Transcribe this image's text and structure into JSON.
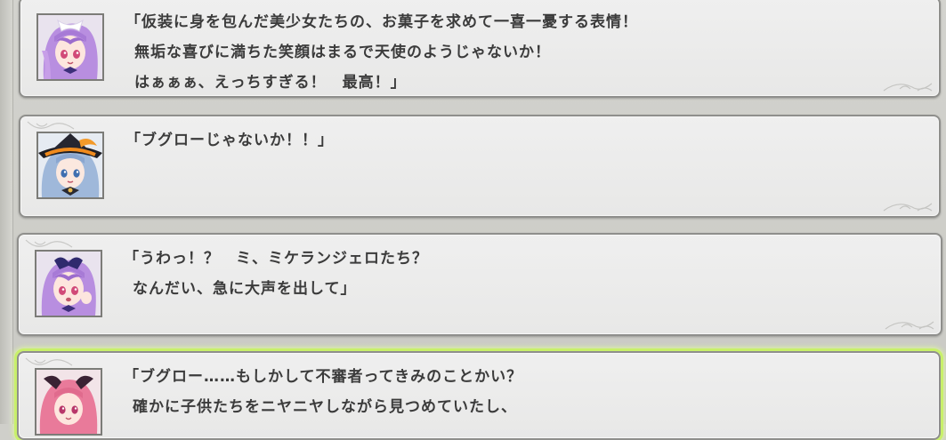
{
  "backlog": {
    "entries": [
      {
        "character": "purple-haired girl (bunny ears, ribbon)",
        "lines": [
          "「仮装に身を包んだ美少女たちの、お菓子を求めて一喜一憂する表情！",
          "無垢な喜びに満ちた笑顔はまるで天使のようじゃないか！",
          "はぁぁぁ、えっちすぎる！　最高！」"
        ]
      },
      {
        "character": "blue-haired girl (orange witch hat)",
        "lines": [
          "「ブグローじゃないか！！」"
        ]
      },
      {
        "character": "purple-haired girl (bunny ears, ribbon)",
        "lines": [
          "「うわっ！？　ミ、ミケランジェロたち？",
          "なんだい、急に大声を出して」"
        ]
      },
      {
        "character": "pink-haired girl (dark ribbon)",
        "lines": [
          "「ブグロー……もしかして不審者ってきみのことかい？",
          "確かに子供たちをニヤニヤしながら見つめていたし、"
        ]
      }
    ]
  },
  "colors": {
    "panel_bg": "#ebebea",
    "panel_border": "#8f8f8c",
    "text": "#3b3b3b",
    "selected_glow": "#c8f06a"
  }
}
